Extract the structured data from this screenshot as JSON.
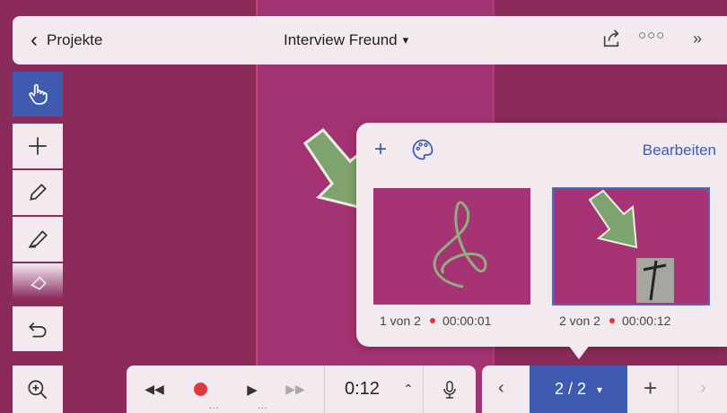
{
  "topbar": {
    "back_label": "Projekte",
    "title": "Interview Freund",
    "icons": [
      "chevron-left-icon",
      "chevron-down-icon",
      "share-icon",
      "more-icon",
      "collapse-icon"
    ]
  },
  "sidebar": {
    "tools": [
      "hand-pointer-icon",
      "plus-icon",
      "pencil-icon",
      "highlighter-icon",
      "eraser-icon",
      "undo-icon"
    ],
    "active_tool": "hand-pointer-icon"
  },
  "zoom": {
    "icon": "zoom-in-icon"
  },
  "playback": {
    "time": "0:12",
    "icons": [
      "rewind-icon",
      "record-icon",
      "play-icon",
      "fast-forward-icon",
      "chevron-up-icon",
      "microphone-icon"
    ],
    "dots": "..."
  },
  "pagenav": {
    "current": "2 / 2",
    "icons": [
      "chevron-left-icon",
      "chevron-down-icon",
      "plus-icon",
      "chevron-right-icon"
    ]
  },
  "popup": {
    "edit_label": "Bearbeiten",
    "slides": [
      {
        "caption": "1 von 2",
        "time": "00:00:01"
      },
      {
        "caption": "2 von 2",
        "time": "00:00:12"
      }
    ]
  },
  "colors": {
    "accent": "#3f5bb0",
    "record": "#e5343a",
    "canvas": "#a33372",
    "panel": "#f3eaf0"
  }
}
